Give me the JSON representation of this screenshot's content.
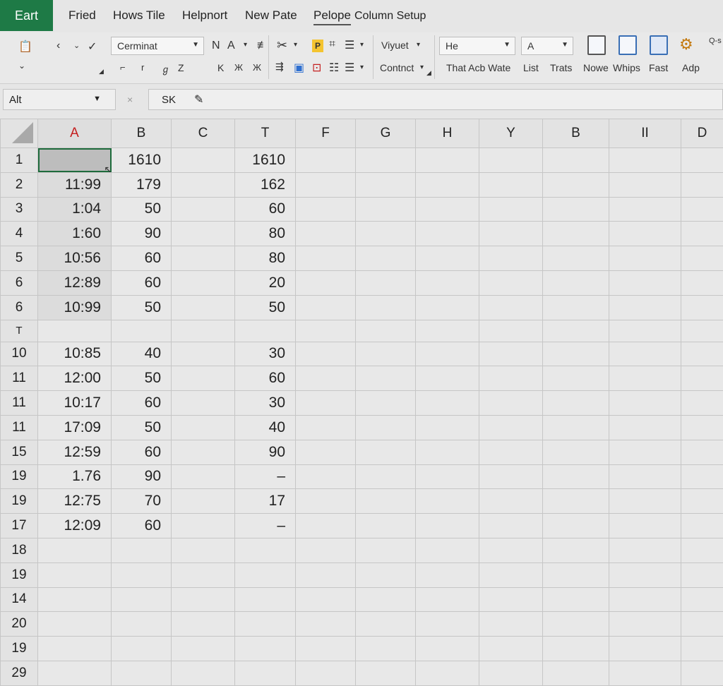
{
  "menu": {
    "file_tab": "Eart",
    "items": [
      "Fried",
      "Hows Tile",
      "Helpnort",
      "New Pate",
      "Pelope",
      "Column Setup"
    ]
  },
  "ribbon": {
    "font_name": "Cerminat",
    "style_dropdown": "Viyuet",
    "style_dropdown2": "Contnct",
    "number_format": "He",
    "font_style_box": "A",
    "row1_glyphs": [
      "N",
      "A"
    ],
    "row2_glyphs": [
      "⌐",
      "r",
      "ℊ",
      "Z",
      "K",
      "Ж",
      "Ж"
    ],
    "big_buttons": [
      "List",
      "Trats",
      "Nowe",
      "Whips",
      "Fast",
      "Adp"
    ],
    "that_label": "That Acb Wate",
    "corner_label": "Q-s"
  },
  "formula_bar": {
    "name_box": "Alt",
    "cancel_glyph": "×",
    "content": "SK"
  },
  "grid": {
    "columns": [
      "A",
      "B",
      "C",
      "T",
      "F",
      "G",
      "H",
      "Y",
      "B",
      "II",
      "D"
    ],
    "rows": [
      {
        "num": "1",
        "A": "",
        "B": "1610",
        "C": "",
        "T": "1610"
      },
      {
        "num": "2",
        "A": "11:99",
        "B": "179",
        "C": "",
        "T": "162"
      },
      {
        "num": "3",
        "A": "1:04",
        "B": "50",
        "C": "",
        "T": "60"
      },
      {
        "num": "4",
        "A": "1:60",
        "B": "90",
        "C": "",
        "T": "80"
      },
      {
        "num": "5",
        "A": "10:56",
        "B": "60",
        "C": "",
        "T": "80"
      },
      {
        "num": "6",
        "A": "12:89",
        "B": "60",
        "C": "",
        "T": "20"
      },
      {
        "num": "6",
        "A": "10:99",
        "B": "50",
        "C": "",
        "T": "50"
      },
      {
        "num": "T",
        "A": "",
        "B": "",
        "C": "",
        "T": ""
      },
      {
        "num": "10",
        "A": "10:85",
        "B": "40",
        "C": "",
        "T": "30"
      },
      {
        "num": "11",
        "A": "12:00",
        "B": "50",
        "C": "",
        "T": "60"
      },
      {
        "num": "11",
        "A": "10:17",
        "B": "60",
        "C": "",
        "T": "30"
      },
      {
        "num": "11",
        "A": "17:09",
        "B": "50",
        "C": "",
        "T": "40"
      },
      {
        "num": "15",
        "A": "12:59",
        "B": "60",
        "C": "",
        "T": "90"
      },
      {
        "num": "19",
        "A": "1.76",
        "B": "90",
        "C": "",
        "T": "–"
      },
      {
        "num": "19",
        "A": "12:75",
        "B": "70",
        "C": "",
        "T": "17"
      },
      {
        "num": "17",
        "A": "12:09",
        "B": "60",
        "C": "",
        "T": "–"
      },
      {
        "num": "18",
        "A": "",
        "B": "",
        "C": "",
        "T": ""
      },
      {
        "num": "19",
        "A": "",
        "B": "",
        "C": "",
        "T": ""
      },
      {
        "num": "14",
        "A": "",
        "B": "",
        "C": "",
        "T": ""
      },
      {
        "num": "20",
        "A": "",
        "B": "",
        "C": "",
        "T": ""
      },
      {
        "num": "19",
        "A": "",
        "B": "",
        "C": "",
        "T": ""
      },
      {
        "num": "29",
        "A": "",
        "B": "",
        "C": "",
        "T": ""
      }
    ]
  },
  "colors": {
    "file_tab_bg": "#1e7a46",
    "selected_column_header": "#c41e1e",
    "active_cell_border": "#1e6b3c"
  }
}
